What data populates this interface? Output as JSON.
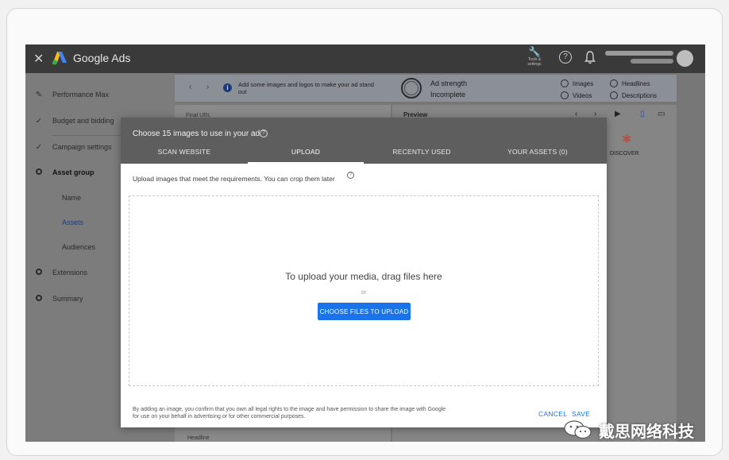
{
  "topbar": {
    "close_icon": "close-icon",
    "brand": "Google Ads",
    "tools_label": "Tools & settings",
    "brand_colors": {
      "blue": "#4285f4",
      "yellow": "#fbbc04",
      "green": "#34a853"
    }
  },
  "sidebar": {
    "items": [
      {
        "label": "Performance Max",
        "icon": "pencil-icon"
      },
      {
        "label": "Budget and bidding",
        "icon": "check-icon"
      },
      {
        "label": "Campaign settings",
        "icon": "check-icon"
      },
      {
        "label": "Asset group",
        "icon": "circle-icon"
      },
      {
        "label": "Name"
      },
      {
        "label": "Assets"
      },
      {
        "label": "Audiences"
      },
      {
        "label": "Extensions",
        "icon": "circle-icon"
      },
      {
        "label": "Summary",
        "icon": "circle-icon"
      }
    ]
  },
  "background": {
    "info_text": "Add some images and logos to make your ad stand out",
    "ad_strength_label": "Ad strength",
    "ad_strength_value": "Incomplete",
    "checklist": [
      "Images",
      "Videos",
      "Headlines",
      "Descriptions"
    ],
    "final_url_label": "Final URL",
    "preview_label": "Preview",
    "discover_label": "DISCOVER",
    "headline_label": "Headline"
  },
  "dialog": {
    "title": "Choose 15 images to use in your ad",
    "tabs": [
      "SCAN WEBSITE",
      "UPLOAD",
      "RECENTLY USED",
      "YOUR ASSETS (0)"
    ],
    "active_tab": "UPLOAD",
    "subtitle": "Upload images that meet the requirements. You can crop them later",
    "drop_title": "To upload your media, drag files here",
    "drop_or": "or",
    "choose_button": "CHOOSE FILES TO UPLOAD",
    "legal": "By adding an image, you confirm that you own all legal rights to the image and have permission to share the image with Google for use on your behalf in advertising or for other commercial purposes.",
    "cancel_button": "CANCEL",
    "save_button": "SAVE",
    "accent_color": "#1a73e8"
  },
  "watermark": {
    "text": "戴思网络科技"
  }
}
